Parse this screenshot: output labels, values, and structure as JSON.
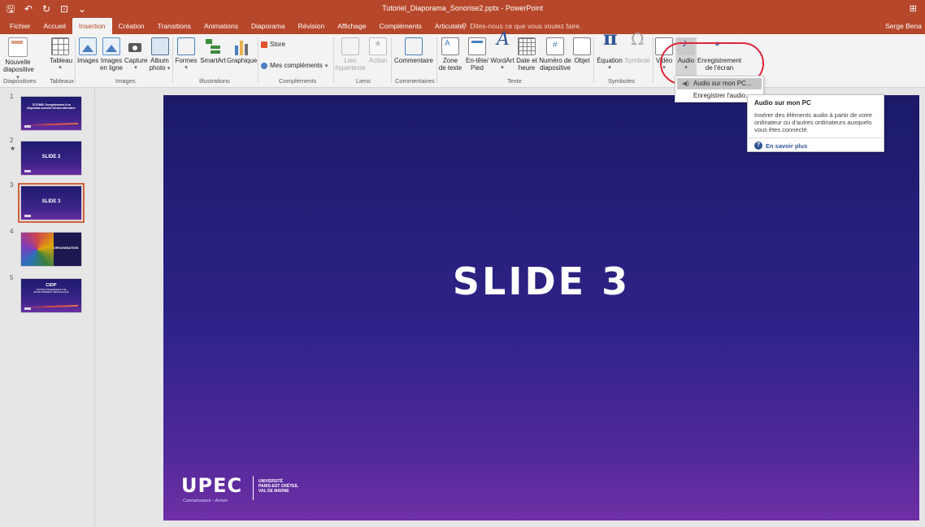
{
  "titlebar": {
    "title": "Tutoriel_Diaporama_Sonorise2.pptx - PowerPoint",
    "qat_save": "🖫",
    "qat_undo": "↶",
    "qat_redo": "↻",
    "qat_present": "⊡",
    "qat_customize": "⌄",
    "window_icon": "⊞",
    "accent_color": "#b7472a"
  },
  "tabs": [
    "Fichier",
    "Accueil",
    "Insertion",
    "Création",
    "Transitions",
    "Animations",
    "Diaporama",
    "Révision",
    "Affichage",
    "Compléments",
    "Articulate"
  ],
  "active_tab": "Insertion",
  "tellme": "Dites-nous ce que vous voulez faire.",
  "user": "Serge Bena",
  "ribbon": {
    "nouvelle": "Nouvelle",
    "diapositive": "diapositive",
    "tableau": "Tableau",
    "images": "Images",
    "images_en_ligne_1": "Images",
    "images_en_ligne_2": "en ligne",
    "capture": "Capture",
    "album_1": "Album",
    "album_2": "photo",
    "formes": "Formes",
    "smartart": "SmartArt",
    "graphique": "Graphique",
    "store": "Store",
    "mes_complements": "Mes compléments",
    "lien_1": "Lien",
    "lien_2": "hypertexte",
    "action": "Action",
    "commentaire": "Commentaire",
    "zone_1": "Zone",
    "zone_2": "de texte",
    "entete_1": "En-tête/",
    "entete_2": "Pied",
    "wordart": "WordArt",
    "date_1": "Date et",
    "date_2": "heure",
    "numero_1": "Numéro de",
    "numero_2": "diapositive",
    "objet": "Objet",
    "equation": "Équation",
    "symbole": "Symbole",
    "video": "Vidéo",
    "audio": "Audio",
    "enregistrement_1": "Enregistrement",
    "enregistrement_2": "de l'écran",
    "dropdown_arrow": "▾"
  },
  "groups": {
    "diapositives": "Diapositives",
    "tableaux": "Tableaux",
    "images": "Images",
    "illustrations": "Illustrations",
    "complements": "Compléments",
    "liens": "Liens",
    "commentaires": "Commentaires",
    "texte": "Texte",
    "symboles": "Symboles"
  },
  "audio_menu": {
    "items": [
      "Audio sur mon PC...",
      "Enregistrer l'audio..."
    ],
    "item_icon": "◀)"
  },
  "tooltip": {
    "title": "Audio sur mon PC",
    "body": "Insérer des éléments audio à partir de votre ordinateur ou d'autres ordinateurs auxquels vous êtes connecté.",
    "help_icon": "?",
    "more": "En savoir plus"
  },
  "thumbnails": [
    {
      "num": "1",
      "text": "TUTORIEL Enregistrement d'un diaporama sonorisé Version alternative"
    },
    {
      "num": "2",
      "text": "SLIDE 2",
      "star": "★"
    },
    {
      "num": "3",
      "text": "SLIDE 3"
    },
    {
      "num": "4",
      "text": "ORGANISATION"
    },
    {
      "num": "5",
      "text": "CIDP",
      "subtext": "CENTRE D'INGENIERIE ET DE DEVELOPPEMENT PEDAGOGIQUE"
    }
  ],
  "selected_slide": "3",
  "slide": {
    "title": "SLIDE 3",
    "logo_main": "UPEC",
    "logo_tagline": "Connaissance - Action",
    "logo_side": [
      "UNIVERSITÉ",
      "PARIS-EST CRÉTEIL",
      "VAL DE MARNE"
    ]
  },
  "colors": {
    "highlight_circle": "#e0243b",
    "slide_top": "#1b1a68",
    "slide_bottom": "#6f30a5"
  }
}
